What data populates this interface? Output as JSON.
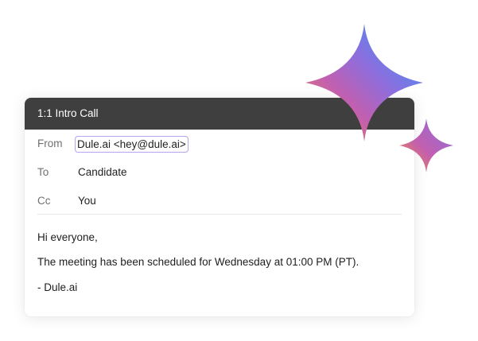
{
  "email": {
    "title": "1:1 Intro Call",
    "from_label": "From",
    "from_value": "Dule.ai <hey@dule.ai>",
    "to_label": "To",
    "to_value": "Candidate",
    "cc_label": "Cc",
    "cc_value": "You",
    "body": {
      "greeting": "Hi everyone,",
      "message": "The meeting has been scheduled for Wednesday at 01:00 PM (PT).",
      "signature": "- Dule.ai"
    }
  },
  "decor": {
    "icons": [
      "sparkle-large-icon",
      "sparkle-small-icon"
    ],
    "gradient_colors": [
      "#f78b3d",
      "#c25fb0",
      "#8a6fe0",
      "#2c9ef0"
    ],
    "titlebar_color": "#3f3f3f",
    "chip_border_color": "#b7a3ec"
  }
}
